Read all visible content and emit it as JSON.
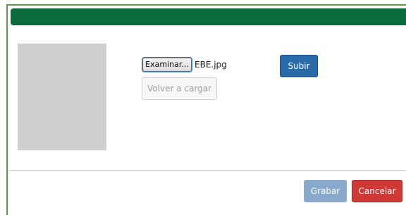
{
  "dialog": {
    "title": "",
    "colors": {
      "header": "#0b6a3b",
      "frame": "#5f9a55",
      "upload": "#2b6aa8",
      "save": "#88a8cc",
      "cancel": "#cf3a36"
    }
  },
  "file_input": {
    "button_label": "Examinar...",
    "selected_file": "EBE.jpg"
  },
  "actions": {
    "reload_label": "Volver a cargar",
    "upload_label": "Subir",
    "save_label": "Grabar",
    "cancel_label": "Cancelar"
  }
}
